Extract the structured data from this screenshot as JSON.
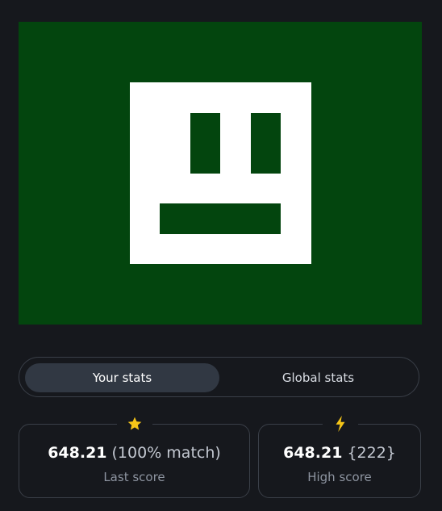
{
  "preview": {
    "background_color": "#03450e",
    "face_color": "#ffffff",
    "icon": "pixel-face-icon"
  },
  "tabs": {
    "your_stats": "Your stats",
    "global_stats": "Global stats",
    "active": "your_stats"
  },
  "stats": {
    "last": {
      "icon": "star-icon",
      "icon_color": "#f5c518",
      "value": "648.21",
      "extra": "(100% match)",
      "label": "Last score"
    },
    "high": {
      "icon": "lightning-icon",
      "icon_color": "#f5c518",
      "value": "648.21",
      "extra": "{222}",
      "label": "High score"
    }
  }
}
